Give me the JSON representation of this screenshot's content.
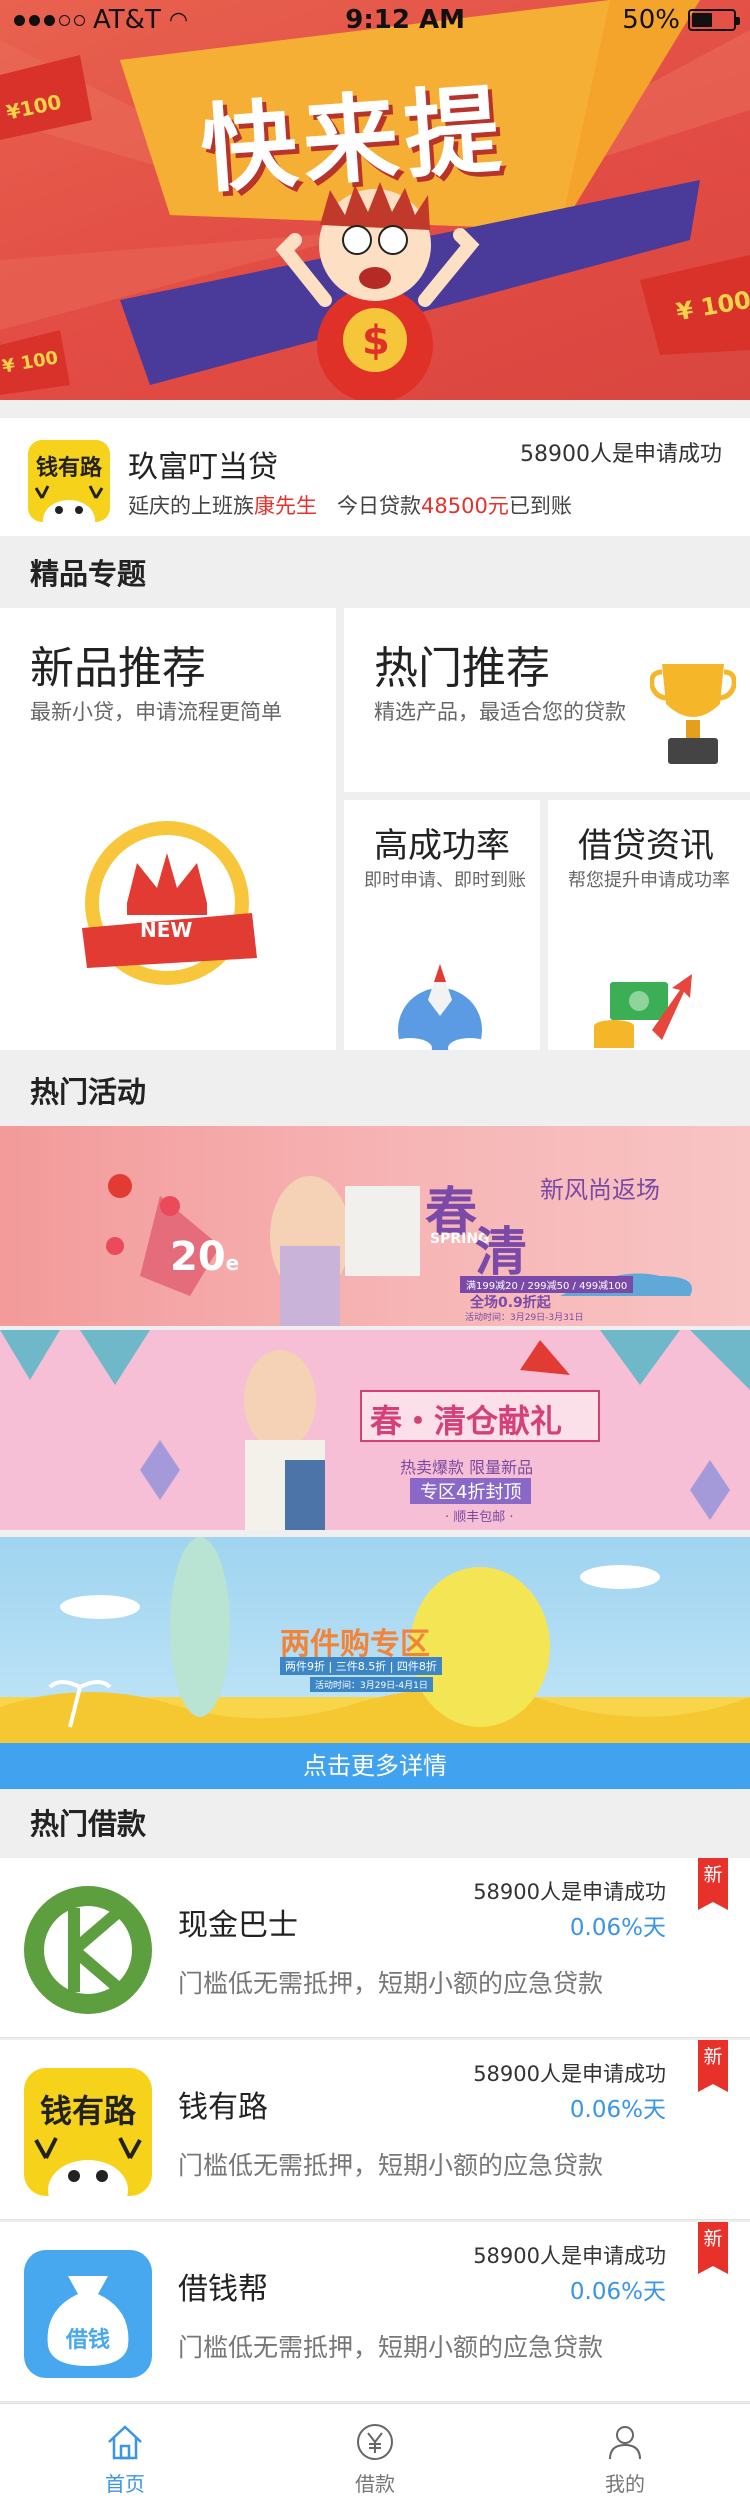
{
  "status_bar": {
    "carrier": "AT&T",
    "time": "9:12 AM",
    "battery": "50%",
    "battery_level": 0.5
  },
  "hero": {
    "headline": "快来提",
    "money_text": "¥ 100",
    "money_text_left": "¥100",
    "money_text_bottom": "¥ 100",
    "coin_symbol": "$"
  },
  "promo": {
    "logo_text": "钱有路",
    "title": "玖富叮当贷",
    "count": "58900人是申请成功",
    "sub_prefix": "延庆的上班族",
    "sub_name": "康先生",
    "sub_mid": "   今日贷款",
    "sub_amount": "48500元",
    "sub_suffix": "已到账"
  },
  "sections": {
    "featured": "精品专题",
    "activities": "热门活动",
    "loans": "热门借款"
  },
  "features": {
    "new": {
      "title": "新品推荐",
      "subtitle": "最新小贷，申请流程更简单",
      "badge": "NEW"
    },
    "hot": {
      "title": "热门推荐",
      "subtitle": "精选产品，最适合您的贷款"
    },
    "success": {
      "title": "高成功率",
      "subtitle": "即时申请、即时到账"
    },
    "consult": {
      "title": "借贷资讯",
      "subtitle": "帮您提升申请成功率"
    }
  },
  "banners": {
    "b1": {
      "title_a": "春",
      "title_b": "清",
      "spring": "SPRING",
      "tag": "新风尚返场",
      "price": "20",
      "price_unit": "e",
      "line1": "满199减20 / 299减50 / 499减100",
      "line2": "全场0.9折起",
      "line3": "活动时间：3月29日-3月31日"
    },
    "b2": {
      "title": "春・清仓献礼",
      "line1": "热卖爆款  限量新品",
      "line2": "专区4折封顶",
      "line3": "· 顺丰包邮 ·"
    },
    "b3": {
      "title": "两件购专区",
      "line1": "两件9折 | 三件8.5折 | 四件8折",
      "line2": "活动时间：3月29日-4月1日"
    },
    "more_label": "点击更多详情"
  },
  "loans": [
    {
      "name": "现金巴士",
      "count": "58900人是申请成功",
      "rate": "0.06%天",
      "desc": "门槛低无需抵押，短期小额的应急贷款",
      "badge": "新",
      "logo": "cash-bus-logo"
    },
    {
      "name": "钱有路",
      "logo_text": "钱有路",
      "count": "58900人是申请成功",
      "rate": "0.06%天",
      "desc": "门槛低无需抵押，短期小额的应急贷款",
      "badge": "新",
      "logo": "qianyoulu-logo"
    },
    {
      "name": "借钱帮",
      "logo_text": "借钱",
      "count": "58900人是申请成功",
      "rate": "0.06%天",
      "desc": "门槛低无需抵押，短期小额的应急贷款",
      "badge": "新",
      "logo": "jieqianbang-logo"
    }
  ],
  "tabs": [
    {
      "label": "首页",
      "icon": "home-icon",
      "active": true
    },
    {
      "label": "借款",
      "icon": "yen-icon",
      "active": false
    },
    {
      "label": "我的",
      "icon": "user-icon",
      "active": false
    }
  ],
  "colors": {
    "accent_red": "#e8312a",
    "accent_blue": "#3a95e8",
    "bar_blue": "#41a2ef"
  }
}
